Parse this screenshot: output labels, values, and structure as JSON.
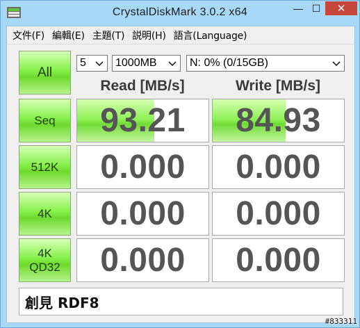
{
  "window": {
    "title": "CrystalDiskMark 3.0.2 x64",
    "minimize_label": "—",
    "maximize_label": "☐",
    "close_label": "✕"
  },
  "menu": {
    "items": [
      "文件(F)",
      "編輯(E)",
      "主題(T)",
      "説明(H)",
      "語言(Language)"
    ]
  },
  "controls": {
    "all_label": "All",
    "count_value": "5",
    "size_value": "1000MB",
    "drive_value": "N: 0% (0/15GB)"
  },
  "headers": {
    "read": "Read [MB/s]",
    "write": "Write [MB/s]"
  },
  "tests": [
    {
      "label_line1": "Seq",
      "label_line2": "",
      "read": "93.21",
      "write": "84.93",
      "read_fill": 0.585,
      "write_fill": 0.555
    },
    {
      "label_line1": "512K",
      "label_line2": "",
      "read": "0.000",
      "write": "0.000",
      "read_fill": 0,
      "write_fill": 0
    },
    {
      "label_line1": "4K",
      "label_line2": "",
      "read": "0.000",
      "write": "0.000",
      "read_fill": 0,
      "write_fill": 0
    },
    {
      "label_line1": "4K",
      "label_line2": "QD32",
      "read": "0.000",
      "write": "0.000",
      "read_fill": 0,
      "write_fill": 0
    }
  ],
  "comment": "創見 RDF8",
  "watermark": "#833311",
  "colors": {
    "titlebar": "#a7d8f6",
    "close_button": "#c7463a",
    "green_accent": "#86f04b",
    "value_text": "#555555"
  }
}
